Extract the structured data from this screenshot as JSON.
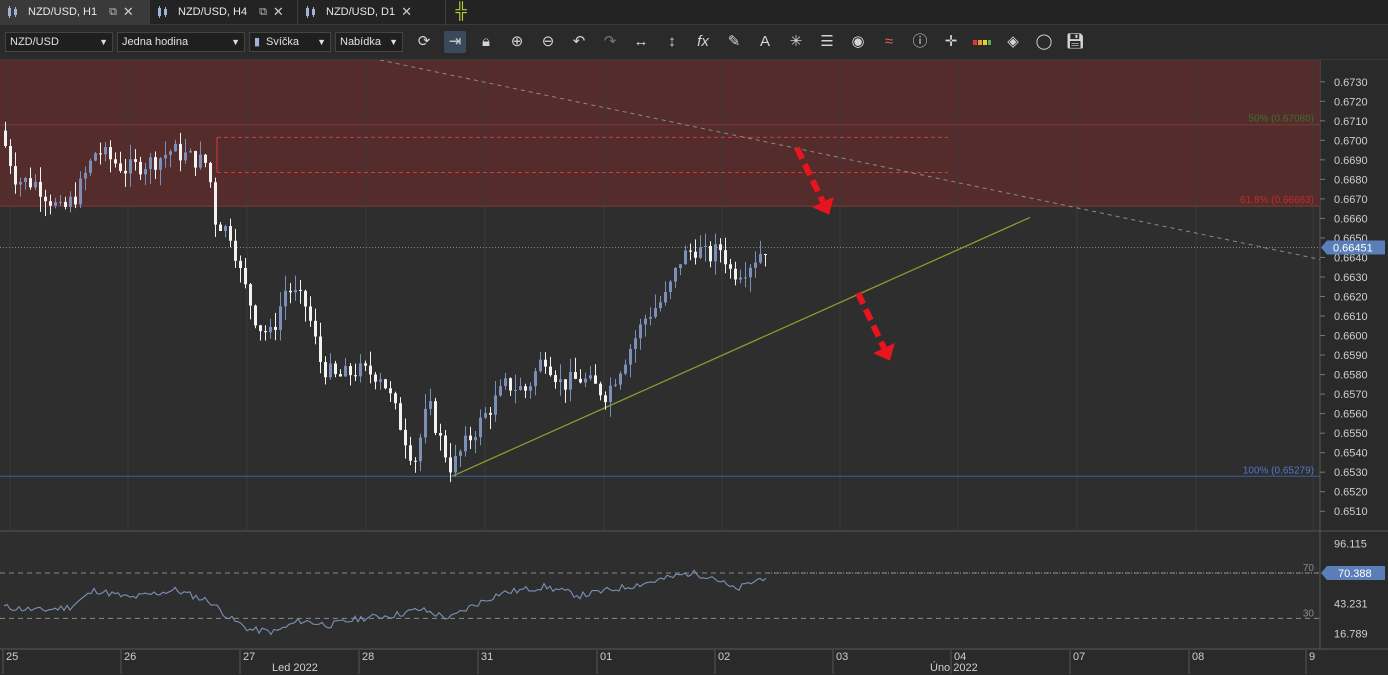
{
  "tabs": [
    {
      "label": "NZD/USD, H1",
      "active": true
    },
    {
      "label": "NZD/USD, H4",
      "active": false
    },
    {
      "label": "NZD/USD, D1",
      "active": false
    }
  ],
  "toolbar": {
    "symbol": "NZD/USD",
    "timeframe": "Jedna hodina",
    "chart_type": "Svíčka",
    "price_type": "Nabídka",
    "icons": [
      "refresh-icon",
      "scroll-end-icon",
      "lock-icon",
      "zoom-in-icon",
      "zoom-out-icon",
      "undo-icon",
      "redo-icon",
      "horizontal-line-icon",
      "vertical-line-icon",
      "indicator-fx-icon",
      "pencil-icon",
      "text-icon",
      "crosshair-tool-icon",
      "layers-icon",
      "eye-icon",
      "signal-icon",
      "info-icon",
      "cross-icon",
      "color-palette-icon",
      "fill-icon",
      "circle-icon",
      "save-icon"
    ]
  },
  "chart_data": {
    "type": "candlestick",
    "instrument": "NZD/USD",
    "timeframe": "H1",
    "ylim": [
      0.6505,
      0.6735
    ],
    "price_ticks": [
      "0.6730",
      "0.6720",
      "0.6710",
      "0.6700",
      "0.6690",
      "0.6680",
      "0.6670",
      "0.6660",
      "0.6650",
      "0.6640",
      "0.6630",
      "0.6620",
      "0.6610",
      "0.6600",
      "0.6590",
      "0.6580",
      "0.6570",
      "0.6560",
      "0.6550",
      "0.6540",
      "0.6530",
      "0.6520",
      "0.6510"
    ],
    "current_price": "0.66451",
    "x_ticks": [
      "25",
      "26",
      "27",
      "28",
      "31",
      "01",
      "02",
      "03",
      "04",
      "07",
      "08",
      "9"
    ],
    "month_labels": [
      "Led 2022",
      "Úno 2022"
    ],
    "fibonacci": [
      {
        "label": "50% (0.67080)",
        "price": 0.6708
      },
      {
        "label": "61.8% (0.66663)",
        "price": 0.66663
      },
      {
        "label": "100% (0.65279)",
        "price": 0.65279
      }
    ],
    "resistance_zone": [
      0.6666,
      0.6735
    ],
    "rsi": {
      "value": "70.388",
      "levels": [
        "70",
        "30"
      ],
      "scale_labels": [
        "96.115",
        "43.231",
        "16.789"
      ]
    },
    "colors": {
      "background": "#2e2e2e",
      "bull": "#7d8fb8",
      "bear": "#f2f2f2",
      "zone": "#5a2b2b",
      "fib_red": "#c52a2a",
      "fib_blue": "#4f78c9",
      "trendline": "#8a9a2e",
      "arrow": "#e8141e"
    }
  }
}
